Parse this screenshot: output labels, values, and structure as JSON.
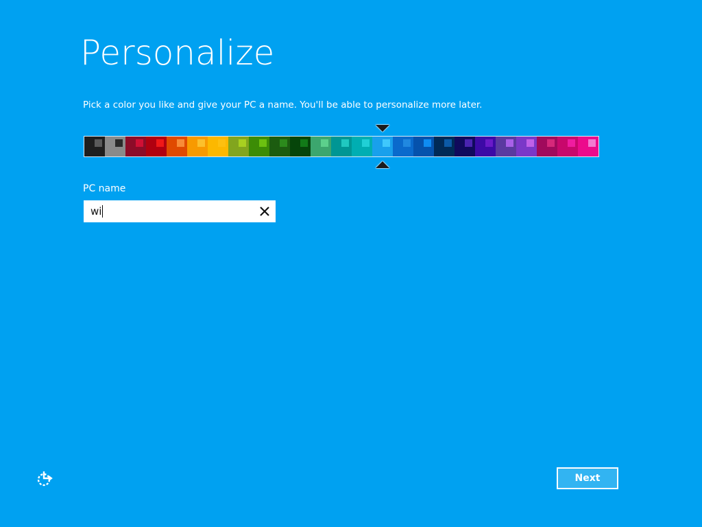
{
  "screen": {
    "background": "#00a1f1",
    "title": "Personalize",
    "instruction": "Pick a color you like and give your PC a name. You'll be able to personalize more later."
  },
  "color_picker": {
    "selected_index": 14,
    "swatches": [
      {
        "bg": "#1e1e1e",
        "chip": "#5a5a5a"
      },
      {
        "bg": "#8a8a8a",
        "chip": "#2a2a2a"
      },
      {
        "bg": "#8c0c28",
        "chip": "#d01035"
      },
      {
        "bg": "#b00010",
        "chip": "#f01818"
      },
      {
        "bg": "#e04a00",
        "chip": "#f88c38"
      },
      {
        "bg": "#f89a00",
        "chip": "#fcc02c"
      },
      {
        "bg": "#fcb800",
        "chip": "#fdc010"
      },
      {
        "bg": "#82a51e",
        "chip": "#a8d020"
      },
      {
        "bg": "#3c8c06",
        "chip": "#6cc010"
      },
      {
        "bg": "#1c5c10",
        "chip": "#2c8a1c"
      },
      {
        "bg": "#06450a",
        "chip": "#127a18"
      },
      {
        "bg": "#3ca66e",
        "chip": "#5cd08c"
      },
      {
        "bg": "#009694",
        "chip": "#20c8c0"
      },
      {
        "bg": "#00aeb2",
        "chip": "#20d0d6"
      },
      {
        "bg": "#19a0ec",
        "chip": "#40c8fc"
      },
      {
        "bg": "#0a6acc",
        "chip": "#2088e0"
      },
      {
        "bg": "#0552ac",
        "chip": "#0f8cf2"
      },
      {
        "bg": "#002a56",
        "chip": "#0c5aa6"
      },
      {
        "bg": "#100a5c",
        "chip": "#4a24b0"
      },
      {
        "bg": "#3c0aa6",
        "chip": "#6a1ac8"
      },
      {
        "bg": "#5a3aa0",
        "chip": "#a860e8"
      },
      {
        "bg": "#7a38c8",
        "chip": "#c060e8"
      },
      {
        "bg": "#a00a5c",
        "chip": "#d6287a"
      },
      {
        "bg": "#c8086c",
        "chip": "#f01ca0"
      },
      {
        "bg": "#ec0a8c",
        "chip": "#f27ad0"
      }
    ]
  },
  "pc_name": {
    "label": "PC name",
    "value": "wi"
  },
  "footer": {
    "next_label": "Next",
    "ease_of_access_icon": "ease-of-access-icon"
  }
}
